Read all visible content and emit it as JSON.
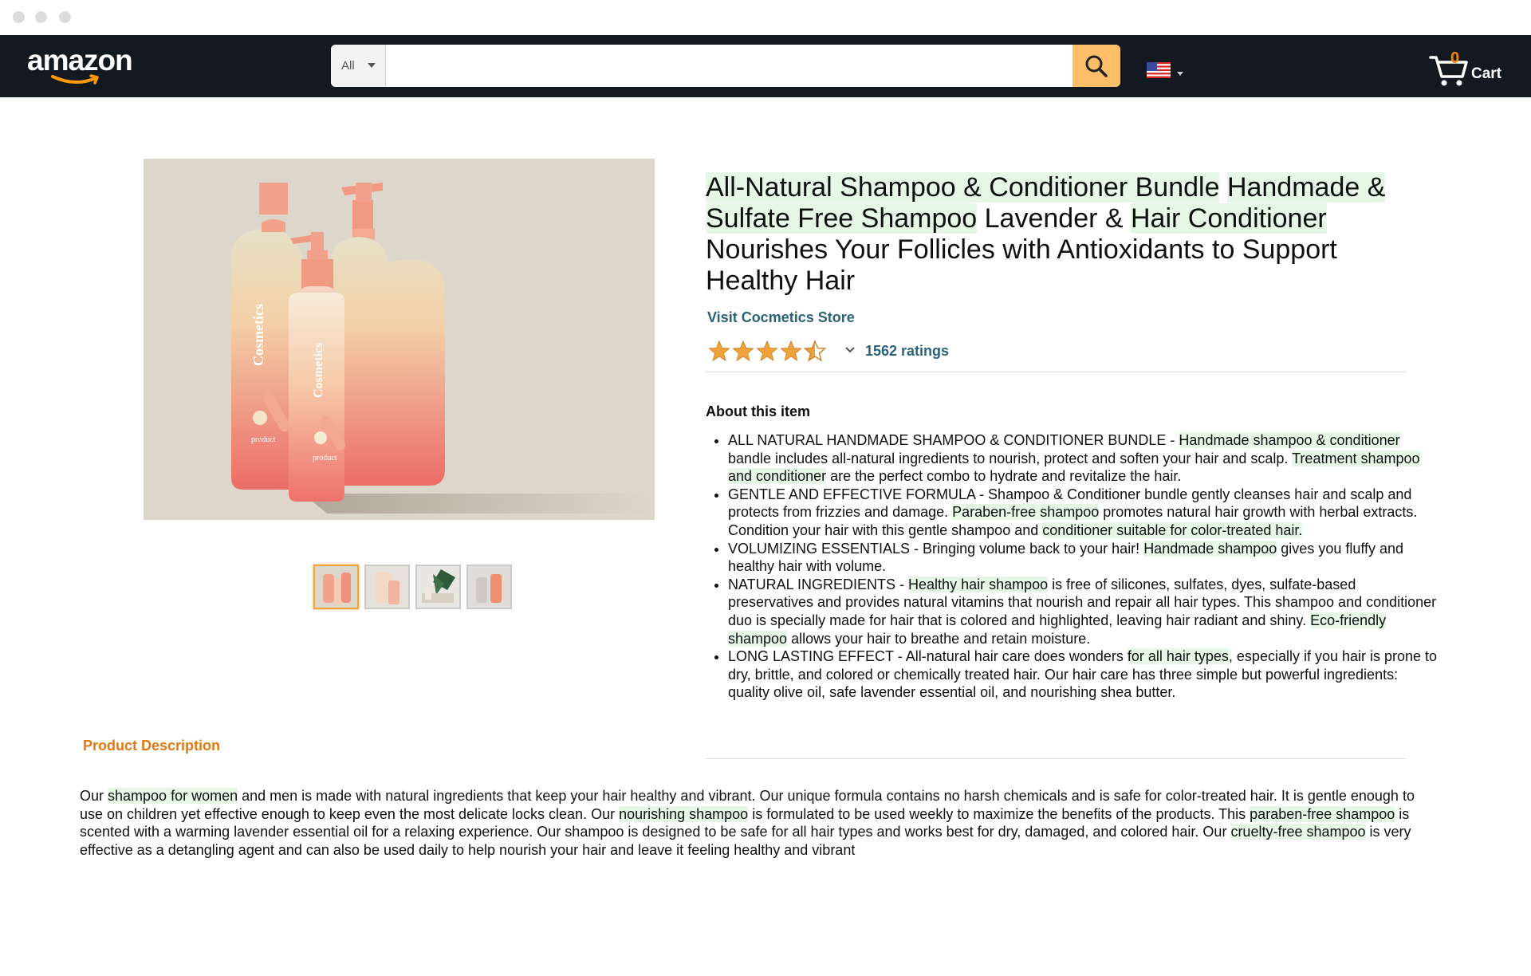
{
  "header": {
    "logo_text": "amazon",
    "search": {
      "category": "All",
      "query": "",
      "placeholder": ""
    },
    "cart": {
      "count": "0",
      "label": "Cart"
    },
    "colors": {
      "nav_bg": "#131921",
      "search_button": "#febd69",
      "cart_count": "#f08804"
    }
  },
  "product": {
    "title_parts": [
      "All-Natural Shampoo & Conditioner Bundle",
      " ",
      "Handmade & Sulfate Free Shampoo",
      " Lavender & ",
      "Hair Conditioner",
      " Nourishes Your Follicles with Antioxidants to Support Healthy Hair"
    ],
    "store_link": "Visit Cocmetics Store",
    "rating": {
      "stars": 4.5,
      "count_label": "1562 ratings"
    },
    "image": {
      "bottle_brand": "Cosmetics",
      "bottle_label": "product",
      "selected_thumbnail": 0,
      "thumbnail_count": 4
    }
  },
  "about": {
    "title": "About this item",
    "bullets": [
      {
        "parts": [
          "ALL NATURAL HANDMADE SHAMPOO & CONDITIONER BUNDLE - ",
          "Handmade shampoo & conditioner",
          " bandle includes all-natural ingredients to nourish, protect and soften your hair and scalp. ",
          "Treatment shampoo and conditioner",
          " are the perfect combo to hydrate and revitalize the hair."
        ]
      },
      {
        "parts": [
          "GENTLE AND EFFECTIVE FORMULA - Shampoo & Conditioner bundle gently cleanses hair and scalp and protects from frizzies and damage. ",
          "Paraben-free shampoo",
          " promotes natural hair growth with herbal extracts. Condition your hair with this gentle shampoo and ",
          "conditioner suitable for color-treated hair.",
          ""
        ]
      },
      {
        "parts": [
          "VOLUMIZING ESSENTIALS - Bringing volume back to your hair! ",
          "Handmade shampoo",
          " gives you fluffy and healthy hair with volume.",
          "",
          ""
        ]
      },
      {
        "parts": [
          "NATURAL INGREDIENTS - ",
          "Healthy hair shampoo",
          " is free of silicones, sulfates, dyes, sulfate-based preservatives and provides natural vitamins that nourish and repair all hair types. This shampoo and conditioner duo is specially made for hair that is colored and highlighted, leaving hair radiant and shiny. ",
          "Eco-friendly shampoo",
          " allows your hair to breathe and retain moisture."
        ]
      },
      {
        "parts": [
          "LONG LASTING EFFECT - All-natural hair care does wonders ",
          "for all hair types",
          ", especially if you hair is prone to dry, brittle, and colored or chemically treated hair. Our hair care has three simple but powerful ingredients: quality olive oil, safe lavender essential oil, and nourishing shea butter.",
          "",
          ""
        ]
      }
    ]
  },
  "description": {
    "title": "Product Description",
    "parts": [
      "Our ",
      "shampoo for women",
      " and men is made with natural ingredients that keep your hair healthy and vibrant. Our unique formula contains no harsh chemicals and is safe for color-treated hair. It is gentle enough to use on children yet effective enough to keep even the most delicate locks clean. Our ",
      "nourishing shampoo",
      " is formulated to be used weekly to maximize the benefits of the products. This ",
      "paraben-free shampoo",
      " is scented with a warming lavender essential oil for a relaxing experience. Our shampoo is designed to be safe for all hair types and works best for dry, damaged, and colored hair. Our ",
      "cruelty-free shampoo",
      " is very effective as a detangling agent and can also be used daily to help nourish your hair and leave it feeling healthy and vibrant"
    ]
  },
  "highlight_color": "#e6f7e6",
  "link_color": "#2a6276",
  "section_title_color": "#e47911"
}
